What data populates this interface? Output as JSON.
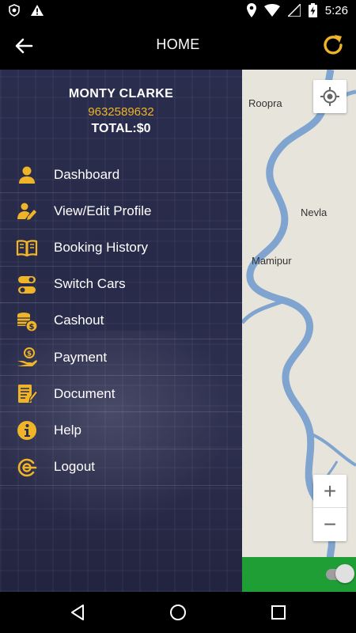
{
  "status_bar": {
    "time": "5:26",
    "battery_level": "charging"
  },
  "app_bar": {
    "title": "HOME"
  },
  "profile": {
    "name": "MONTY CLARKE",
    "phone": "9632589632",
    "total": "TOTAL:$0"
  },
  "menu": [
    {
      "label": "Dashboard",
      "icon": "user-icon"
    },
    {
      "label": "View/Edit Profile",
      "icon": "edit-profile-icon"
    },
    {
      "label": "Booking History",
      "icon": "book-icon"
    },
    {
      "label": "Switch Cars",
      "icon": "switch-icon"
    },
    {
      "label": "Cashout",
      "icon": "coins-icon"
    },
    {
      "label": "Payment",
      "icon": "payment-icon"
    },
    {
      "label": "Document",
      "icon": "document-icon"
    },
    {
      "label": "Help",
      "icon": "info-icon"
    },
    {
      "label": "Logout",
      "icon": "logout-icon"
    }
  ],
  "map": {
    "places": [
      "Roopra",
      "Nevla",
      "Mamipur"
    ],
    "zoom_in": "+",
    "zoom_out": "−"
  },
  "colors": {
    "accent": "#f0b429",
    "drawer_bg": "#2a2d4d",
    "online_green": "#1f9e35",
    "river": "#7fa4cf"
  }
}
